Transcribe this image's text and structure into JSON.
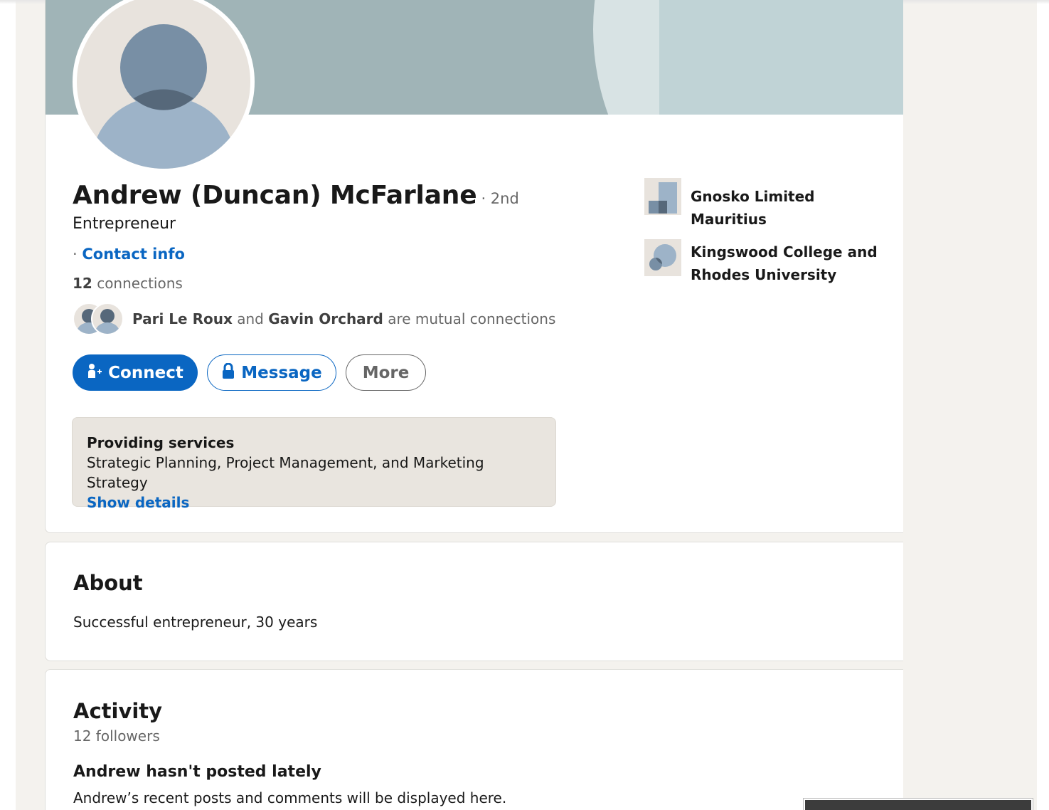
{
  "profile": {
    "name": "Andrew (Duncan) McFarlane",
    "degree": "· 2nd",
    "headline": "Entrepreneur",
    "contact_prefix": "·",
    "contact_label": "Contact info",
    "connections_count": "12",
    "connections_label": "connections",
    "mutual": {
      "person1": "Pari Le Roux",
      "and": "and",
      "person2": "Gavin Orchard",
      "suffix": "are mutual connections"
    }
  },
  "actions": {
    "connect_label": "Connect",
    "message_label": "Message",
    "more_label": "More"
  },
  "services": {
    "title": "Providing services",
    "list": "Strategic Planning, Project Management, and Marketing Strategy",
    "link": "Show details"
  },
  "organizations": [
    {
      "name": "Gnosko Limited Mauritius",
      "icon": "company-logo-icon"
    },
    {
      "name": "Kingswood College and Rhodes University",
      "icon": "school-logo-icon"
    }
  ],
  "about": {
    "title": "About",
    "text": "Successful entrepreneur, 30 years"
  },
  "activity": {
    "title": "Activity",
    "followers": "12 followers",
    "empty_title": "Andrew hasn't posted lately",
    "empty_desc": "Andrew’s recent posts and comments will be displayed here."
  },
  "colors": {
    "accent": "#0a66c2",
    "page_bg": "#f4f2ee",
    "banner": "#a0b4b7"
  }
}
